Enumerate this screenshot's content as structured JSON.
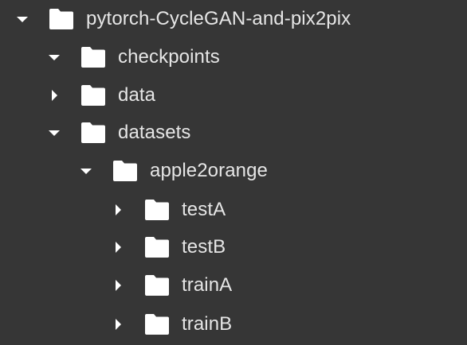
{
  "file_tree": {
    "items": [
      {
        "label": "pytorch-CycleGAN-and-pix2pix",
        "expanded": true,
        "icon": "folder-icon",
        "toggle_icon": "caret-down-icon"
      },
      {
        "label": "checkpoints",
        "expanded": true,
        "icon": "folder-icon",
        "toggle_icon": "caret-down-icon"
      },
      {
        "label": "data",
        "expanded": false,
        "icon": "folder-icon",
        "toggle_icon": "caret-right-icon"
      },
      {
        "label": "datasets",
        "expanded": true,
        "icon": "folder-icon",
        "toggle_icon": "caret-down-icon"
      },
      {
        "label": "apple2orange",
        "expanded": true,
        "icon": "folder-icon",
        "toggle_icon": "caret-down-icon"
      },
      {
        "label": "testA",
        "expanded": false,
        "icon": "folder-icon",
        "toggle_icon": "caret-right-icon"
      },
      {
        "label": "testB",
        "expanded": false,
        "icon": "folder-icon",
        "toggle_icon": "caret-right-icon"
      },
      {
        "label": "trainA",
        "expanded": false,
        "icon": "folder-icon",
        "toggle_icon": "caret-right-icon"
      },
      {
        "label": "trainB",
        "expanded": false,
        "icon": "folder-icon",
        "toggle_icon": "caret-right-icon"
      }
    ]
  },
  "colors": {
    "background": "#363636",
    "text": "#e6e6e6",
    "icon": "#ffffff"
  }
}
